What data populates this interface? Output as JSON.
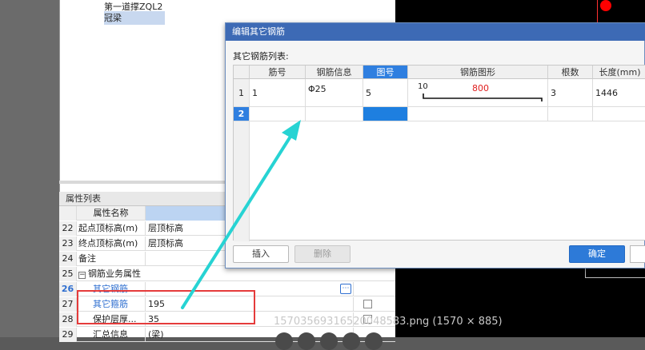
{
  "tree": {
    "items": [
      "第一道撑ZQL2",
      "冠梁"
    ]
  },
  "properties": {
    "panel_title": "属性列表",
    "header_name": "属性名称",
    "rows": [
      {
        "num": "22",
        "name": "起点顶标高(m)",
        "value": "层顶标高"
      },
      {
        "num": "23",
        "name": "终点顶标高(m)",
        "value": "层顶标高"
      },
      {
        "num": "24",
        "name": "备注",
        "value": ""
      },
      {
        "num": "25",
        "name": "钢筋业务属性",
        "value": ""
      },
      {
        "num": "26",
        "name": "其它钢筋",
        "value": ""
      },
      {
        "num": "27",
        "name": "其它箍筋",
        "value": "195"
      },
      {
        "num": "28",
        "name": "保护层厚...",
        "value": "35"
      },
      {
        "num": "29",
        "name": "汇总信息",
        "value": "(梁)"
      }
    ],
    "expand_symbol": "−",
    "ellipsis": "⋯"
  },
  "dialog": {
    "title": "编辑其它钢筋",
    "list_label": "其它钢筋列表:",
    "columns": [
      "筋号",
      "钢筋信息",
      "图号",
      "钢筋图形",
      "根数",
      "长度(mm)"
    ],
    "rows": [
      {
        "row_num": "1",
        "bar_no": "1",
        "bar_info": "Φ25",
        "fig_no": "5",
        "shape_left": "10",
        "shape_len": "800",
        "count": "3",
        "length": "1446"
      },
      {
        "row_num": "2",
        "bar_no": "",
        "bar_info": "",
        "fig_no": "",
        "shape_left": "",
        "shape_len": "",
        "count": "",
        "length": ""
      }
    ],
    "buttons": {
      "insert": "插入",
      "delete": "删除",
      "ok": "确定"
    }
  },
  "watermark": "15703569316520048583.png (1570 × 885)",
  "colors": {
    "title_bar": "#3d6ab5",
    "selected_cell": "#1e7fe0",
    "annotation_red": "#e53b3b",
    "arrow": "#27d3d3",
    "shape_red": "#e02020"
  }
}
